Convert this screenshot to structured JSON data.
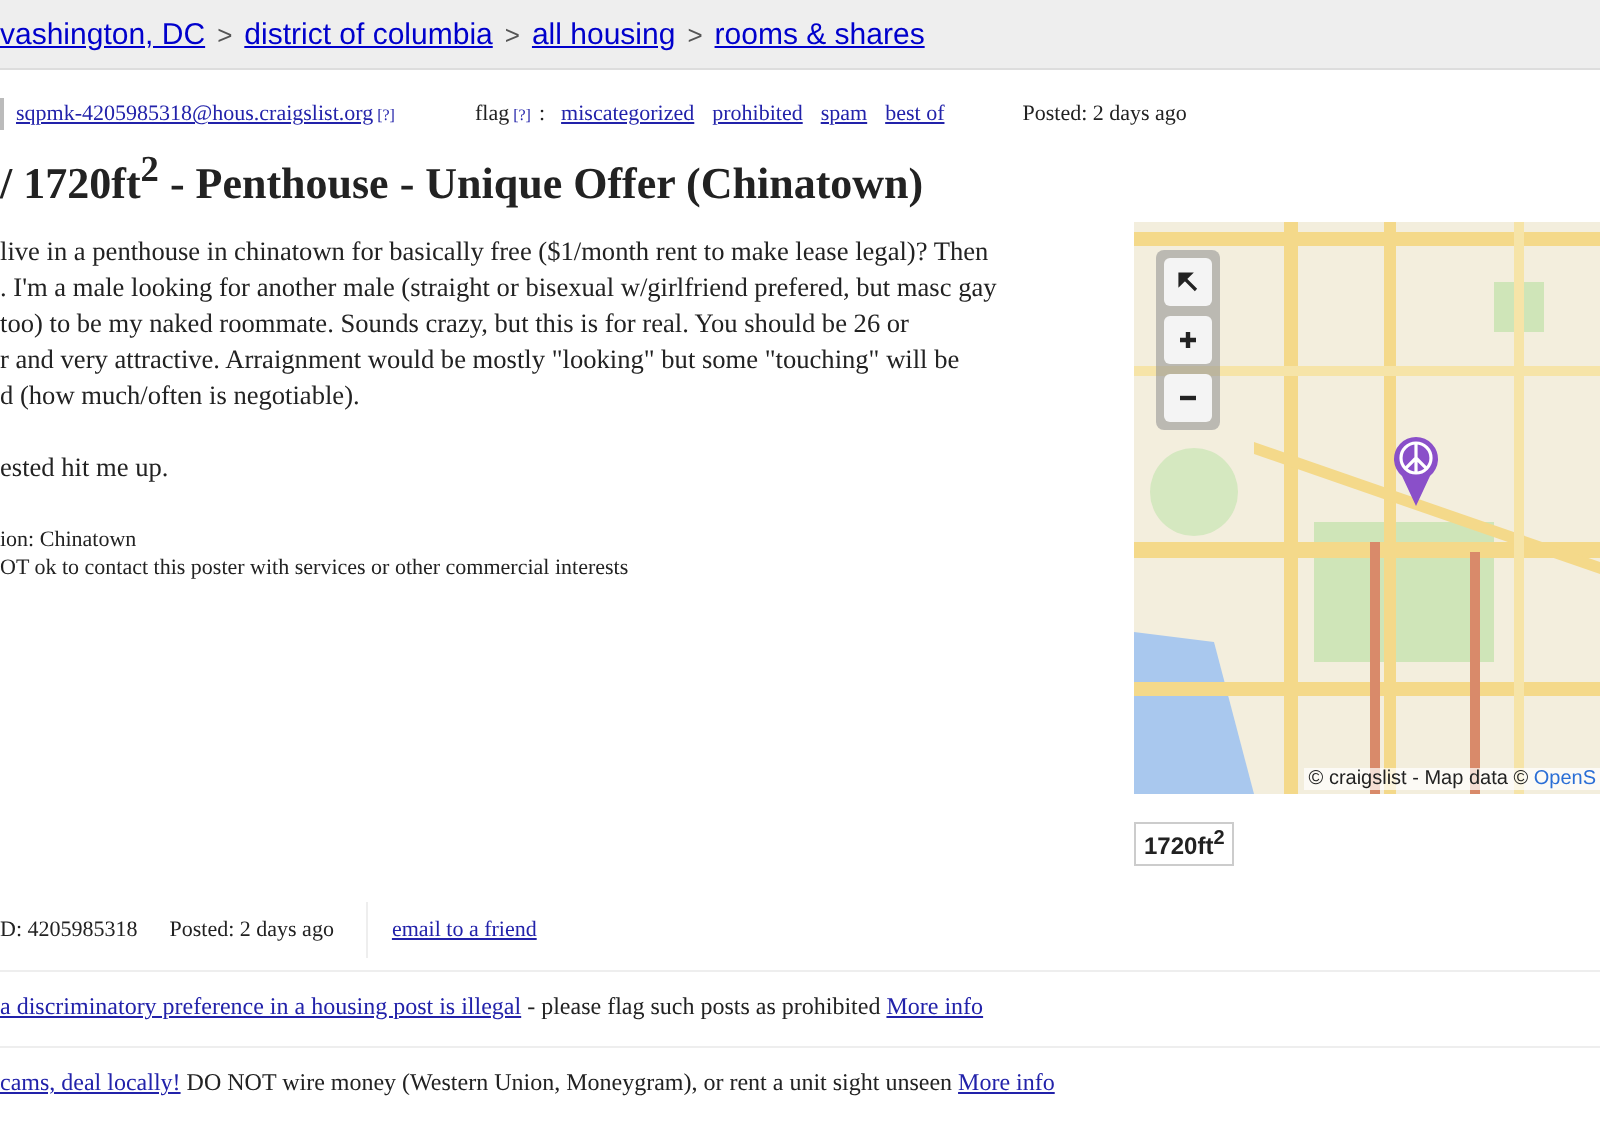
{
  "breadcrumbs": [
    {
      "label": "vashington, DC"
    },
    {
      "label": "district of columbia"
    },
    {
      "label": "all housing"
    },
    {
      "label": "rooms & shares"
    }
  ],
  "breadcrumb_separator": ">",
  "reply": {
    "email": "sqpmk-4205985318@hous.craigslist.org",
    "help_mark": "[?]"
  },
  "flag": {
    "label": "flag",
    "help_mark": "[?]",
    "separator": ":",
    "links": [
      "miscategorized",
      "prohibited",
      "spam",
      "best of"
    ]
  },
  "posted_top": "Posted: 2 days ago",
  "title": "/ 1720ft$^{2}$ - Penthouse - Unique Offer (Chinatown)",
  "body_lines": [
    "live in a penthouse in chinatown for basically free ($1/month rent to make lease legal)? Then",
    ". I'm a male looking for another male (straight or bisexual w/girlfriend prefered, but masc gay",
    "too) to be my naked roommate. Sounds crazy, but this is for real. You should be 26 or",
    "r and very attractive. Arraignment would be mostly \"looking\" but some \"touching\" will be",
    "d (how much/often is negotiable)."
  ],
  "closing_line": "ested hit me up.",
  "notes": [
    "ion: Chinatown",
    "OT ok to contact this poster with services or other commercial interests"
  ],
  "map": {
    "attribution": "© craigslist - Map data © ",
    "attribution_link": "OpenS"
  },
  "area_badge": "1720ft$^{2}$",
  "footer": {
    "post_id": "D: 4205985318",
    "posted": "Posted: 2 days ago",
    "email_link": "email to a friend"
  },
  "notices": [
    {
      "link": "a discriminatory preference in a housing post is illegal",
      "text": " - please flag such posts as prohibited ",
      "more": "More info"
    },
    {
      "link": "cams, deal locally!",
      "text": " DO NOT wire money (Western Union, Moneygram), or rent a unit sight unseen ",
      "more": "More info"
    }
  ]
}
